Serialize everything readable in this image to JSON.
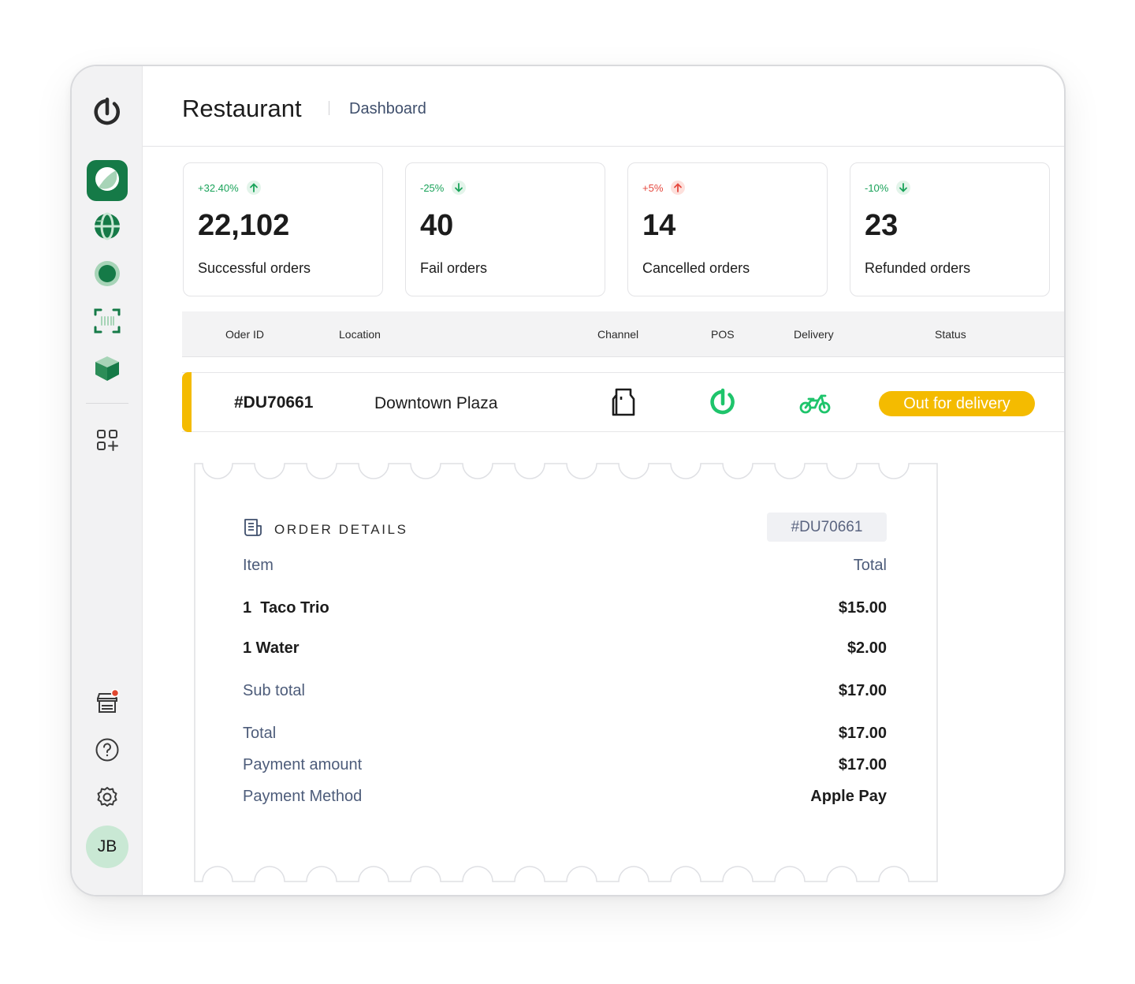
{
  "app": {
    "title": "Restaurant",
    "breadcrumb": "Dashboard"
  },
  "sidebar": {
    "items": [
      {
        "icon": "brand-logo-icon"
      },
      {
        "icon": "dashboard-icon",
        "active": true
      },
      {
        "icon": "globe-icon"
      },
      {
        "icon": "live-dot-icon"
      },
      {
        "icon": "barcode-scan-icon"
      },
      {
        "icon": "box-icon"
      },
      {
        "icon": "add-widget-icon"
      },
      {
        "icon": "store-icon",
        "notification": true
      },
      {
        "icon": "help-icon"
      },
      {
        "icon": "settings-icon"
      }
    ],
    "user_initials": "JB"
  },
  "stats": [
    {
      "delta": "+32.40%",
      "direction": "up",
      "delta_color": "#1aa35a",
      "value": "22,102",
      "label": "Successful orders"
    },
    {
      "delta": "-25%",
      "direction": "down",
      "delta_color": "#1aa35a",
      "value": "40",
      "label": "Fail orders"
    },
    {
      "delta": "+5%",
      "direction": "up",
      "delta_color": "#e5483e",
      "value": "14",
      "label": "Cancelled orders"
    },
    {
      "delta": "-10%",
      "direction": "down",
      "delta_color": "#1aa35a",
      "value": "23",
      "label": "Refunded orders"
    }
  ],
  "table": {
    "columns": [
      "Oder ID",
      "Location",
      "Channel",
      "POS",
      "Delivery",
      "Status"
    ],
    "rows": [
      {
        "order_id": "#DU70661",
        "location": "Downtown Plaza",
        "channel_icon": "bag-icon",
        "pos_icon": "pos-brand-icon",
        "delivery_icon": "motorbike-icon",
        "status": "Out for delivery",
        "status_color": "#f4bb00"
      }
    ]
  },
  "order_details": {
    "title": "ORDER DETAILS",
    "order_id": "#DU70661",
    "col_item": "Item",
    "col_total": "Total",
    "items": [
      {
        "name": "1  Taco Trio",
        "price": "$15.00"
      },
      {
        "name": "1 Water",
        "price": "$2.00"
      }
    ],
    "subtotal_label": "Sub total",
    "subtotal": "$17.00",
    "total_label": "Total",
    "total": "$17.00",
    "payment_amount_label": "Payment amount",
    "payment_amount": "$17.00",
    "payment_method_label": "Payment Method",
    "payment_method": "Apple Pay"
  },
  "colors": {
    "brand": "#157a47",
    "accent": "#f4bb00",
    "positive": "#1aa35a",
    "negative": "#e5483e"
  }
}
